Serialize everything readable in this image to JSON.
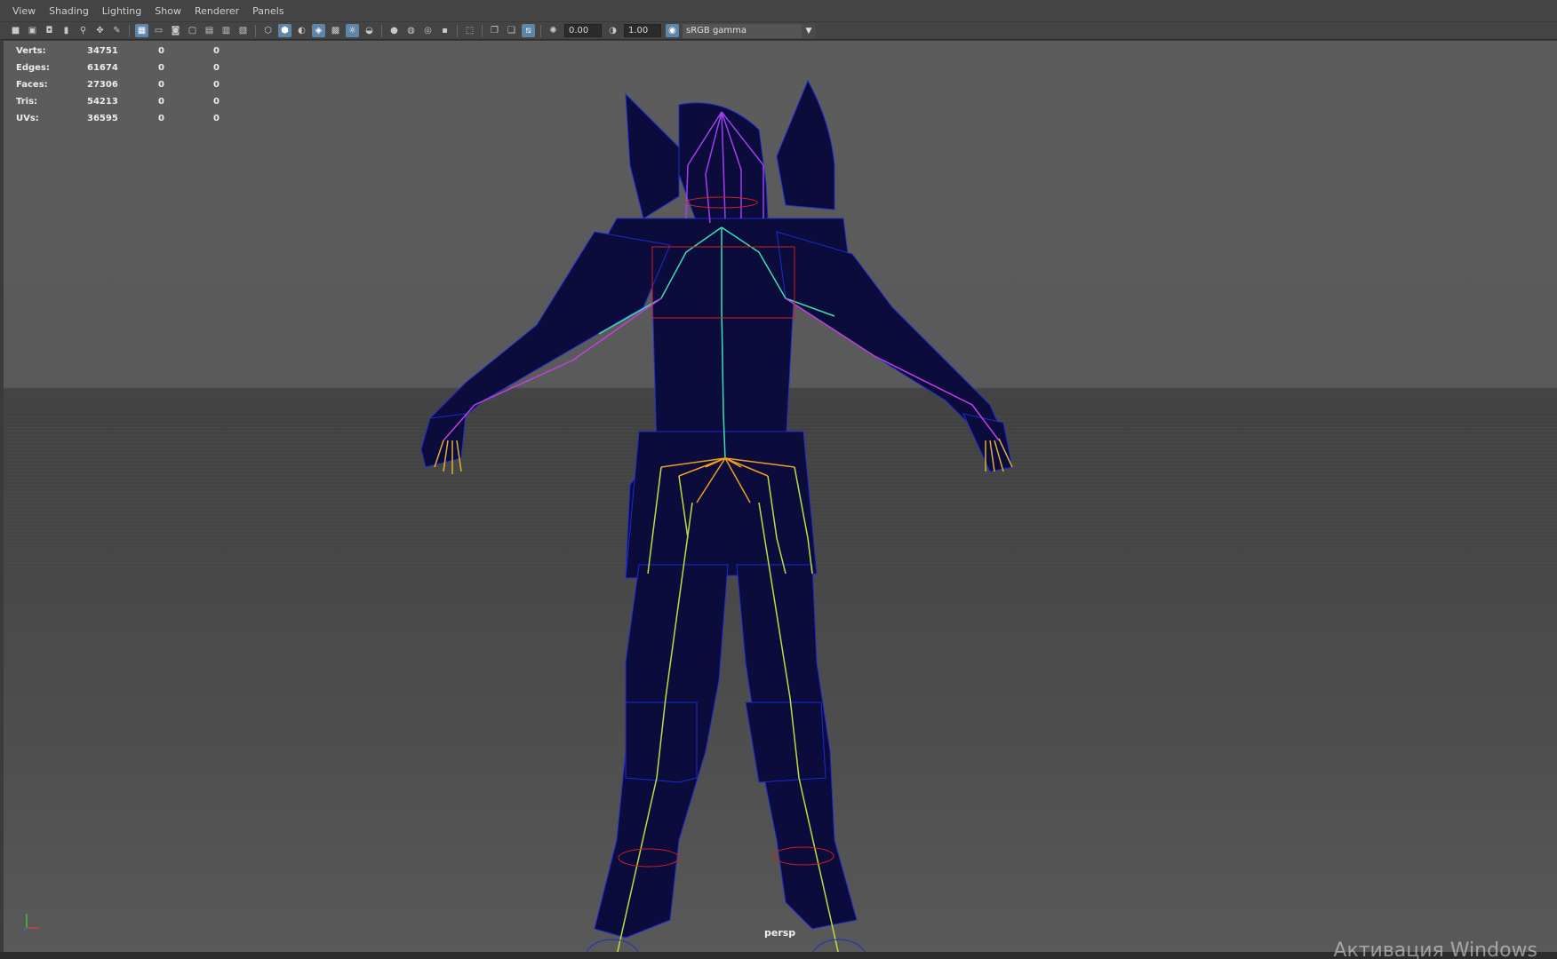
{
  "menubar": {
    "items": [
      "View",
      "Shading",
      "Lighting",
      "Show",
      "Renderer",
      "Panels"
    ]
  },
  "toolbar": {
    "exposure": "0.00",
    "gamma": "1.00",
    "color_space": "sRGB gamma"
  },
  "hud": {
    "rows": [
      {
        "label": "Verts:",
        "v1": "34751",
        "v2": "0",
        "v3": "0"
      },
      {
        "label": "Edges:",
        "v1": "61674",
        "v2": "0",
        "v3": "0"
      },
      {
        "label": "Faces:",
        "v1": "27306",
        "v2": "0",
        "v3": "0"
      },
      {
        "label": "Tris:",
        "v1": "54213",
        "v2": "0",
        "v3": "0"
      },
      {
        "label": "UVs:",
        "v1": "36595",
        "v2": "0",
        "v3": "0"
      }
    ]
  },
  "viewport": {
    "camera": "persp"
  },
  "watermark": "Активация Windows",
  "colors": {
    "mesh": "#0a0a3a",
    "wire": "#1e2bd0",
    "spine": "#3fe0b0",
    "arms": "#c040e0",
    "legs": "#b8e040",
    "hips": "#f0a020",
    "controls": "#d02020"
  }
}
